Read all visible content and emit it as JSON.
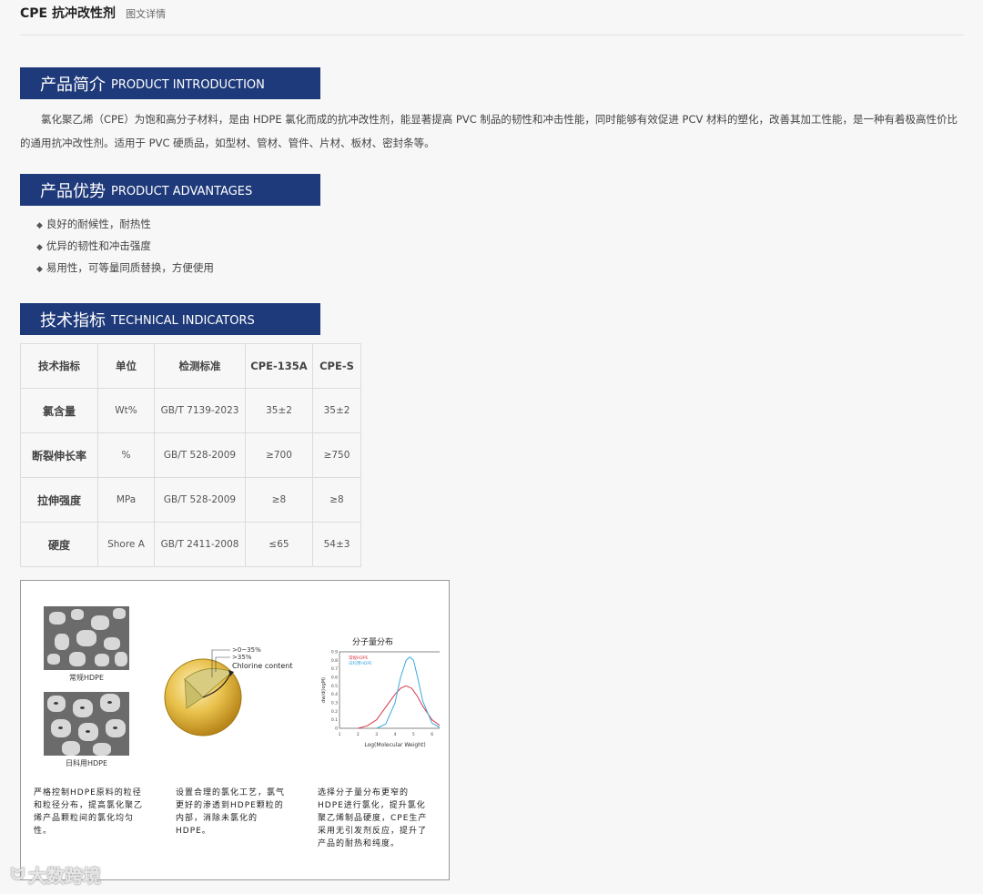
{
  "header": {
    "title": "CPE 抗冲改性剂",
    "tab": "图文详情"
  },
  "sections": {
    "intro": {
      "cn": "产品简介",
      "en": "PRODUCT INTRODUCTION"
    },
    "advantages": {
      "cn": "产品优势",
      "en": "PRODUCT ADVANTAGES"
    },
    "indicators": {
      "cn": "技术指标",
      "en": "TECHNICAL INDICATORS"
    }
  },
  "intro_text": "氯化聚乙烯（CPE）为饱和高分子材料，是由 HDPE 氯化而成的抗冲改性剂，能显著提高 PVC 制品的韧性和冲击性能，同时能够有效促进 PCV 材料的塑化，改善其加工性能，是一种有着极高性价比的通用抗冲改性剂。适用于 PVC 硬质品，如型材、管材、管件、片材、板材、密封条等。",
  "advantages": [
    "良好的耐候性，耐热性",
    "优异的韧性和冲击强度",
    "易用性，可等量同质替换，方便使用"
  ],
  "table": {
    "headers": [
      "技术指标",
      "单位",
      "检测标准",
      "CPE-135A",
      "CPE-S"
    ],
    "rows": [
      [
        "氯含量",
        "Wt%",
        "GB/T 7139-2023",
        "35±2",
        "35±2"
      ],
      [
        "断裂伸长率",
        "%",
        "GB/T 528-2009",
        "≥700",
        "≥750"
      ],
      [
        "拉伸强度",
        "MPa",
        "GB/T 528-2009",
        "≥8",
        "≥8"
      ],
      [
        "硬度",
        "Shore A",
        "GB/T 2411-2008",
        "≤65",
        "54±3"
      ]
    ]
  },
  "figure": {
    "img1_caption": "常规HDPE",
    "img2_caption": "日科用HDPE",
    "sphere_labels": [
      ">0~35%",
      ">35%",
      "Chlorine content"
    ],
    "text1": "严格控制HDPE原料的粒径和粒径分布，提高氯化聚乙烯产品颗粒间的氯化均匀性。",
    "text2": "设置合理的氯化工艺，氯气更好的渗透到HDPE颗粒的内部，消除未氯化的HDPE。",
    "text3": "选择分子量分布更窄的HDPE进行氯化，提升氯化聚乙烯制品硬度，CPE生产采用无引发剂反应，提升了产品的耐热和纯度。"
  },
  "chart_data": {
    "type": "line",
    "title": "分子量分布",
    "xlabel": "Log(Molecular Weight)",
    "ylabel": "dw/d(logM)",
    "xlim": [
      1,
      7
    ],
    "ylim": [
      0,
      0.9
    ],
    "xticks": [
      1,
      2,
      3,
      4,
      5,
      6,
      7
    ],
    "yticks": [
      0,
      0.1,
      0.2,
      0.3,
      0.4,
      0.5,
      0.6,
      0.7,
      0.8,
      0.9
    ],
    "legend": "top-left",
    "series": [
      {
        "name": "常规HDPE",
        "color": "#d63a4a",
        "x": [
          2,
          2.5,
          3,
          3.5,
          4,
          4.3,
          4.6,
          4.9,
          5.2,
          5.5,
          6,
          6.5
        ],
        "y": [
          0.0,
          0.03,
          0.1,
          0.25,
          0.4,
          0.47,
          0.5,
          0.47,
          0.38,
          0.26,
          0.1,
          0.02
        ]
      },
      {
        "name": "日科用HDPE",
        "color": "#3aaae0",
        "x": [
          3,
          3.5,
          4,
          4.3,
          4.6,
          4.8,
          5.0,
          5.2,
          5.5,
          6,
          6.5
        ],
        "y": [
          0.0,
          0.05,
          0.3,
          0.6,
          0.8,
          0.84,
          0.8,
          0.62,
          0.32,
          0.06,
          0.0
        ]
      }
    ]
  },
  "watermark": "大数跨境"
}
